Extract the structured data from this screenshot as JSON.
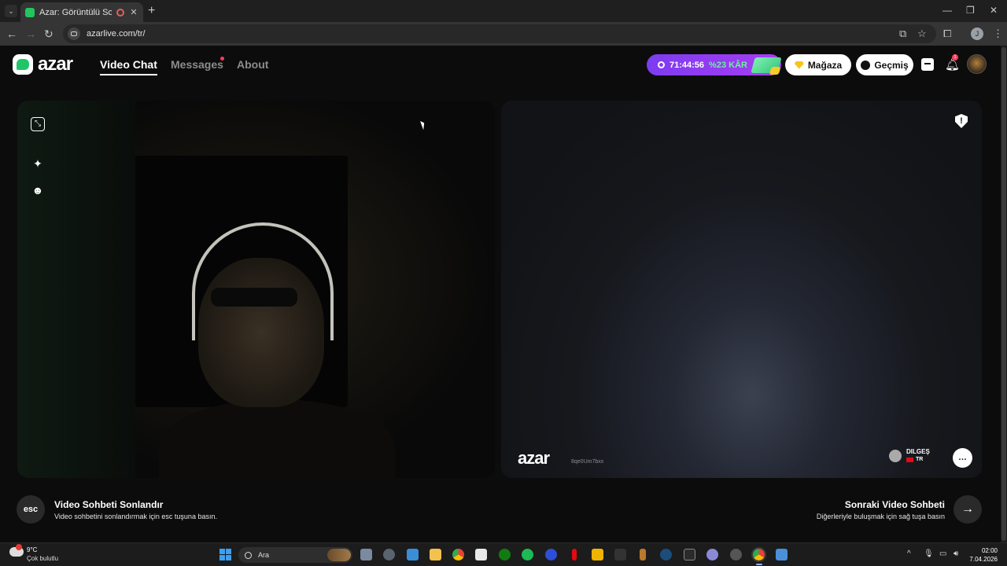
{
  "browser": {
    "tab_title": "Azar: Görüntülü Sohbet & V",
    "url": "azarlive.com/tr/",
    "profile_initial": "J"
  },
  "header": {
    "logo_text": "azar",
    "nav": {
      "video_chat": "Video Chat",
      "messages": "Messages",
      "about": "About"
    },
    "timer": "71:44:56",
    "discount": "%23 KÂR",
    "store_label": "Mağaza",
    "history_label": "Geçmiş",
    "notification_count": "1"
  },
  "partner": {
    "watermark_logo": "azar",
    "watermark_id": "8qe0Um7bxx",
    "name": "DILGEŞ",
    "country": "TR"
  },
  "footer": {
    "esc_label": "esc",
    "end_title": "Video Sohbeti Sonlandır",
    "end_sub": "Video sohbetini sonlandırmak için esc tuşuna basın.",
    "next_title": "Sonraki Video Sohbeti",
    "next_sub": "Diğerleriyle buluşmak için sağ tuşa basın"
  },
  "taskbar": {
    "weather_temp": "9°C",
    "weather_desc": "Çok bulutlu",
    "search_placeholder": "Ara",
    "time": "02:00",
    "date": "7.04.2026"
  },
  "colors": {
    "accent_green": "#20c56a",
    "timer_purple": "#8a3cf0",
    "badge_red": "#ff3b5c"
  }
}
